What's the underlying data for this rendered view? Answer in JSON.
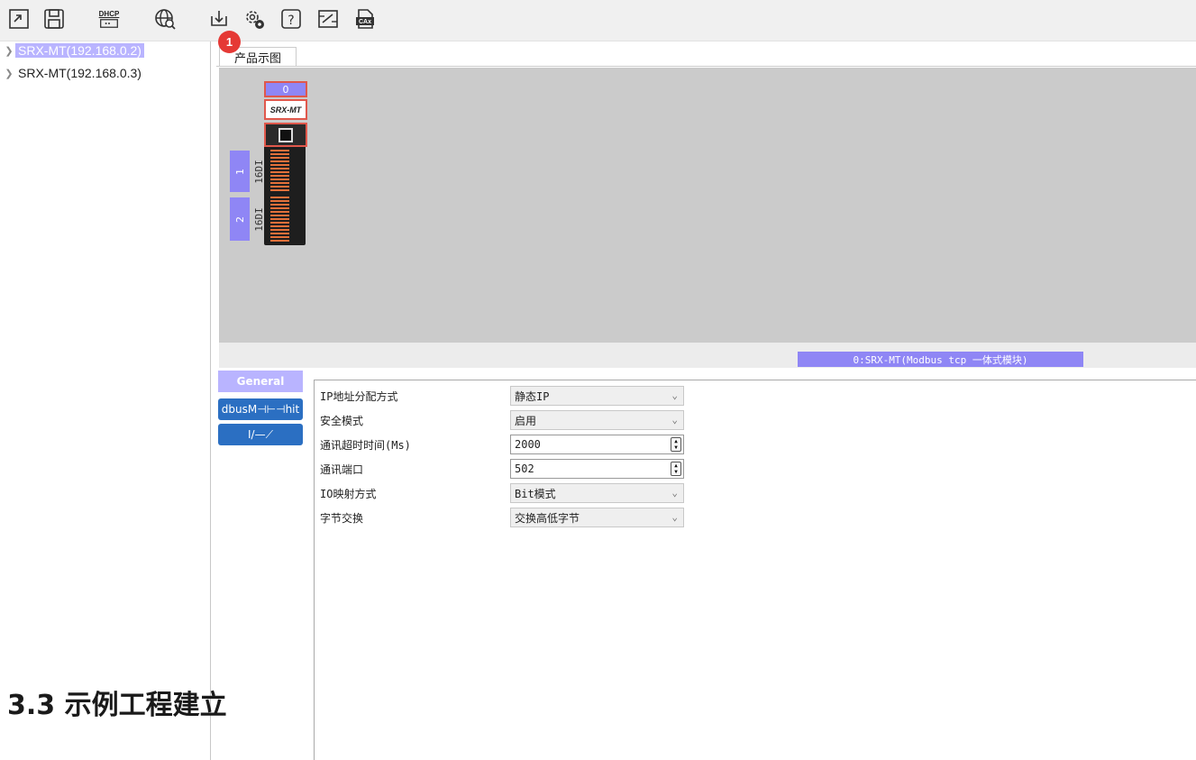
{
  "toolbar": {
    "icons": [
      "open-project-icon",
      "save-icon",
      "dhcp-icon",
      "network-scan-icon",
      "download-icon",
      "settings-icon",
      "help-icon",
      "edit-config-icon",
      "cax-export-icon"
    ],
    "dhcp_label": "DHCP",
    "cax_label": "CAx",
    "badge_count": "1"
  },
  "tree": {
    "items": [
      {
        "label": "SRX-MT(192.168.0.2)",
        "selected": true
      },
      {
        "label": "SRX-MT(192.168.0.3)",
        "selected": false
      }
    ]
  },
  "tabs": {
    "product_view": "产品示图"
  },
  "canvas": {
    "head_slot": "0",
    "head_name": "SRX-MT",
    "io_modules": [
      {
        "slot": "1",
        "type": "16DI"
      },
      {
        "slot": "2",
        "type": "16DI"
      }
    ]
  },
  "status": {
    "text": "0:SRX-MT(Modbus tcp 一体式模块)"
  },
  "side_tabs": {
    "general": "General",
    "modbus": "dbusM⊣⊢⊣hit",
    "io": "I/—⟋"
  },
  "properties": [
    {
      "label": "IP地址分配方式",
      "value": "静态IP",
      "control": "dropdown"
    },
    {
      "label": "安全模式",
      "value": "启用",
      "control": "dropdown"
    },
    {
      "label": "通讯超时时间(Ms)",
      "value": "2000",
      "control": "spinbox"
    },
    {
      "label": "通讯端口",
      "value": "502",
      "control": "spinbox"
    },
    {
      "label": "IO映射方式",
      "value": "Bit模式",
      "control": "dropdown"
    },
    {
      "label": "字节交换",
      "value": "交换高低字节",
      "control": "dropdown"
    }
  ],
  "overlay": {
    "heading": "3.3 示例工程建立"
  },
  "colors": {
    "accent": "#8f86f5",
    "selection": "#b9b4ff",
    "badge": "#e53935",
    "tab_blue": "#2b6fc2"
  }
}
